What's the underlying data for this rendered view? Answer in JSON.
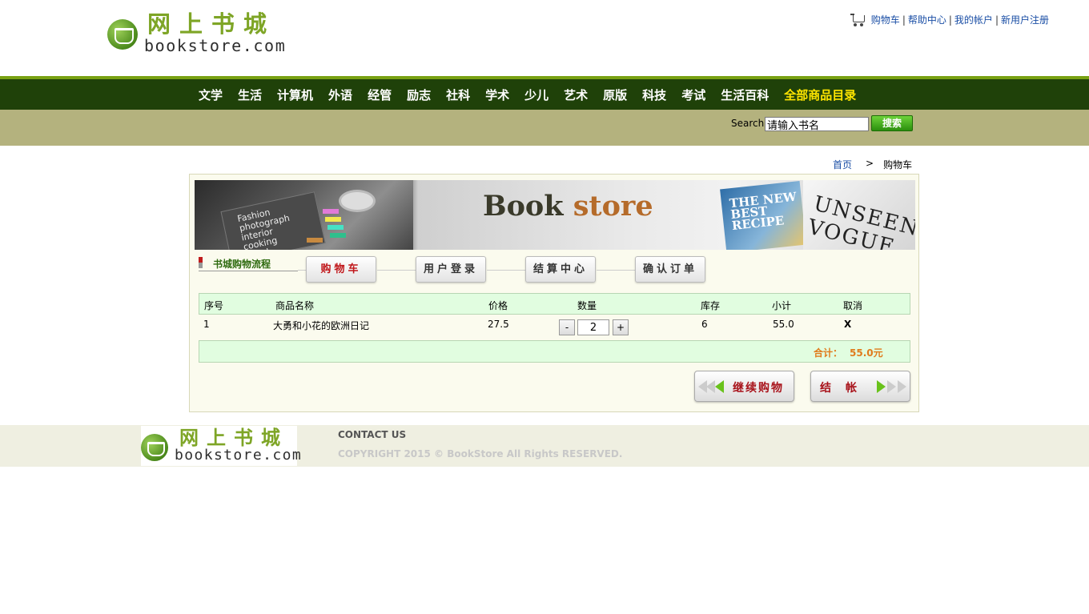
{
  "header": {
    "logo_cn": "网上书城",
    "logo_en": "bookstore.com",
    "links": [
      {
        "label": "购物车"
      },
      {
        "label": "帮助中心"
      },
      {
        "label": "我的帐户"
      },
      {
        "label": "新用户注册"
      }
    ],
    "separator": "|"
  },
  "nav": {
    "items": [
      "文学",
      "生活",
      "计算机",
      "外语",
      "经管",
      "励志",
      "社科",
      "学术",
      "少儿",
      "艺术",
      "原版",
      "科技",
      "考试",
      "生活百科"
    ],
    "highlight_item": "全部商品目录"
  },
  "search": {
    "label": "Search",
    "value": "请输入书名",
    "button_label": "搜索"
  },
  "breadcrumb": {
    "home": "首页",
    "arrow": ">",
    "current": "购物车"
  },
  "banner": {
    "title_main": "Book ",
    "title_accent": "store",
    "paper_text": "Fashion\nphotograph\ninterior\ncooking\nnovel",
    "book1_text": "THE NEW BEST RECIPE",
    "book2_text": "UNSEEN VOGUE"
  },
  "process": {
    "label": "书城购物流程",
    "steps": [
      "购物车",
      "用户登录",
      "结算中心",
      "确认订单"
    ]
  },
  "cart": {
    "columns": [
      "序号",
      "商品名称",
      "价格",
      "数量",
      "库存",
      "小计",
      "取消"
    ],
    "rows": [
      {
        "index": "1",
        "name": "大勇和小花的欧洲日记",
        "price": "27.5",
        "qty": "2",
        "stock": "6",
        "subtotal": "55.0",
        "remove": "X",
        "minus": "-",
        "plus": "+"
      }
    ],
    "total_label": "合计：",
    "total_value": "55.0元"
  },
  "actions": {
    "continue_label": "继续购物",
    "checkout_label": "结　帐"
  },
  "footer": {
    "logo_cn": "网上书城",
    "logo_en": "bookstore.com",
    "contact": "CONTACT US",
    "copyright": "COPYRIGHT 2015 © BookStore All Rights RESERVED."
  },
  "colors": {
    "nav_bg": "#1f4109",
    "nav_accent_line": "#79a113",
    "search_bar_bg": "#b4b27e",
    "table_header_bg": "#e1fde0",
    "total_text": "#e07b1c",
    "remove_red": "#e01010",
    "link_blue": "#1a4ea5"
  }
}
